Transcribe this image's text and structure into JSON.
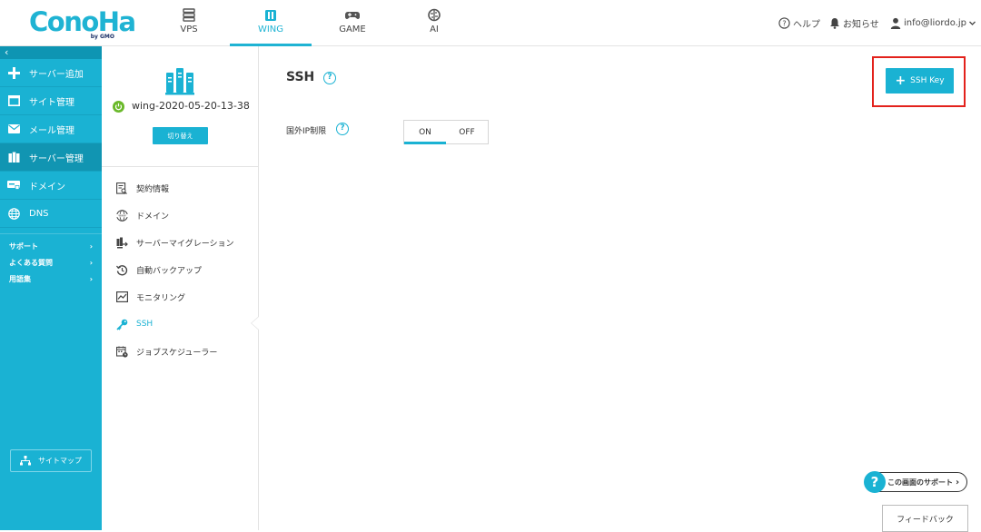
{
  "brand": {
    "logo": "ConoHa",
    "logo_sub": "by GMO",
    "accent": "#1ab2d3",
    "highlight": "#e3221c"
  },
  "services": [
    {
      "label": "VPS",
      "icon": "server-stack-icon",
      "active": false
    },
    {
      "label": "WING",
      "icon": "wing-icon",
      "active": true
    },
    {
      "label": "GAME",
      "icon": "gamepad-icon",
      "active": false
    },
    {
      "label": "AI",
      "icon": "brain-icon",
      "active": false
    }
  ],
  "header_right": {
    "help": "ヘルプ",
    "notifications": "お知らせ",
    "account": "info@liordo.jp"
  },
  "sidebar": {
    "collapse_glyph": "‹",
    "items": [
      {
        "label": "サーバー追加",
        "icon": "plus-icon"
      },
      {
        "label": "サイト管理",
        "icon": "window-icon"
      },
      {
        "label": "メール管理",
        "icon": "mail-icon"
      },
      {
        "label": "サーバー管理",
        "icon": "server-icon",
        "active": true
      },
      {
        "label": "ドメイン",
        "icon": "domain-icon"
      },
      {
        "label": "DNS",
        "icon": "globe-icon"
      }
    ],
    "links": [
      {
        "label": "サポート"
      },
      {
        "label": "よくある質問"
      },
      {
        "label": "用語集"
      }
    ],
    "sitemap": "サイトマップ"
  },
  "server_panel": {
    "name": "wing-2020-05-20-13-38",
    "status": "running",
    "switch_label": "切り替え",
    "menu": [
      {
        "label": "契約情報",
        "icon": "contract-icon"
      },
      {
        "label": "ドメイン",
        "icon": "www-icon"
      },
      {
        "label": "サーバーマイグレーション",
        "icon": "migration-icon"
      },
      {
        "label": "自動バックアップ",
        "icon": "backup-icon"
      },
      {
        "label": "モニタリング",
        "icon": "monitoring-icon"
      },
      {
        "label": "SSH",
        "icon": "key-icon",
        "active": true
      },
      {
        "label": "ジョブスケジューラー",
        "icon": "scheduler-icon"
      }
    ]
  },
  "main": {
    "title": "SSH",
    "foreign_ip_label": "国外IP制限",
    "toggle": {
      "on": "ON",
      "off": "OFF",
      "selected": "ON"
    },
    "add_key_label": "SSH Key",
    "support_label": "この画面のサポート",
    "feedback_label": "フィードバック"
  }
}
